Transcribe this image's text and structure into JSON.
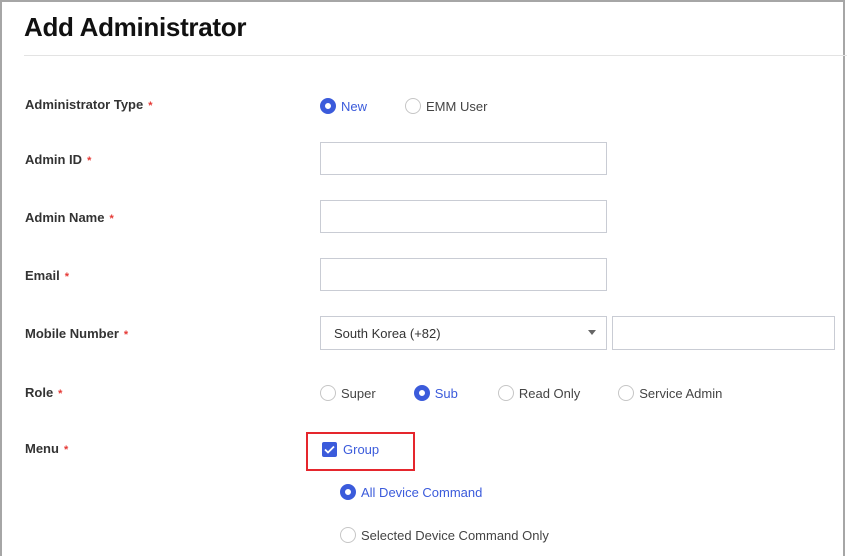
{
  "page": {
    "title": "Add Administrator"
  },
  "form": {
    "required_marker": "*",
    "administrator_type": {
      "label": "Administrator Type",
      "options": [
        {
          "label": "New",
          "checked": true
        },
        {
          "label": "EMM User",
          "checked": false
        }
      ]
    },
    "admin_id": {
      "label": "Admin ID",
      "value": ""
    },
    "admin_name": {
      "label": "Admin Name",
      "value": ""
    },
    "email": {
      "label": "Email",
      "value": ""
    },
    "mobile_number": {
      "label": "Mobile Number",
      "country_selected": "South Korea (+82)",
      "number_value": ""
    },
    "role": {
      "label": "Role",
      "options": [
        {
          "label": "Super",
          "checked": false
        },
        {
          "label": "Sub",
          "checked": true
        },
        {
          "label": "Read Only",
          "checked": false
        },
        {
          "label": "Service Admin",
          "checked": false
        }
      ]
    },
    "menu": {
      "label": "Menu",
      "group_checkbox": {
        "label": "Group",
        "checked": true
      },
      "command_options": [
        {
          "label": "All Device Command",
          "checked": true
        },
        {
          "label": "Selected Device Command Only",
          "checked": false
        }
      ]
    }
  },
  "colors": {
    "accent": "#3b5bdb",
    "required": "#e53935",
    "highlight": "#e5262d"
  }
}
